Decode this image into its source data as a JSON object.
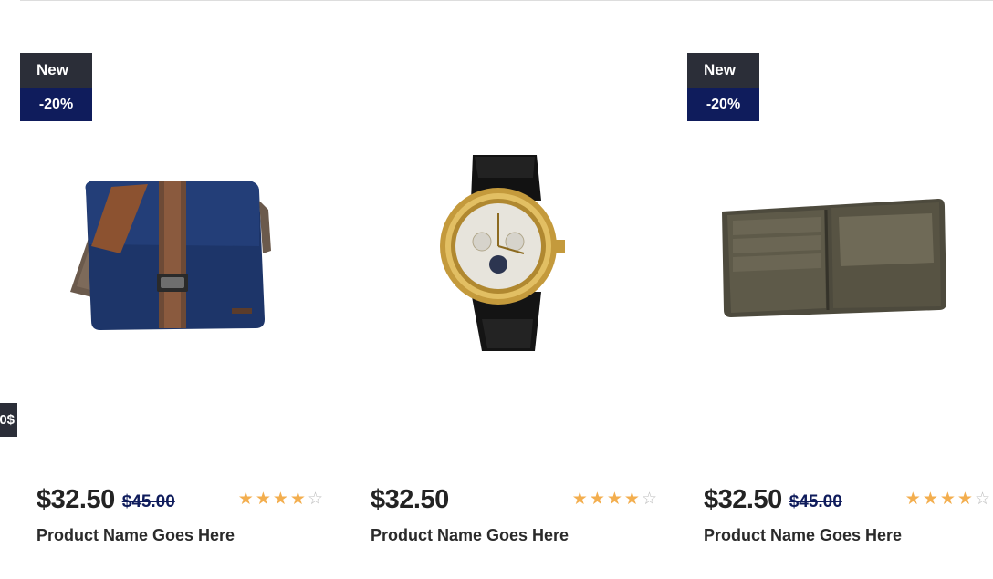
{
  "side_tab": {
    "label": "0$"
  },
  "products": [
    {
      "badge_new": "New",
      "badge_discount": "-20%",
      "image": "messenger-bag",
      "price": "$32.50",
      "old_price": "$45.00",
      "rating": 4,
      "rating_max": 5,
      "name": "Product Name Goes Here"
    },
    {
      "badge_new": "",
      "badge_discount": "",
      "image": "wristwatch",
      "price": "$32.50",
      "old_price": "",
      "rating": 4,
      "rating_max": 5,
      "name": "Product Name Goes Here"
    },
    {
      "badge_new": "New",
      "badge_discount": "-20%",
      "image": "wallet",
      "price": "$32.50",
      "old_price": "$45.00",
      "rating": 4,
      "rating_max": 5,
      "name": "Product Name Goes Here"
    }
  ],
  "colors": {
    "badge_new_bg": "#2b2e38",
    "badge_discount_bg": "#0f1c5c",
    "star_on": "#f3ae4e",
    "star_off": "#bdbdbd"
  }
}
